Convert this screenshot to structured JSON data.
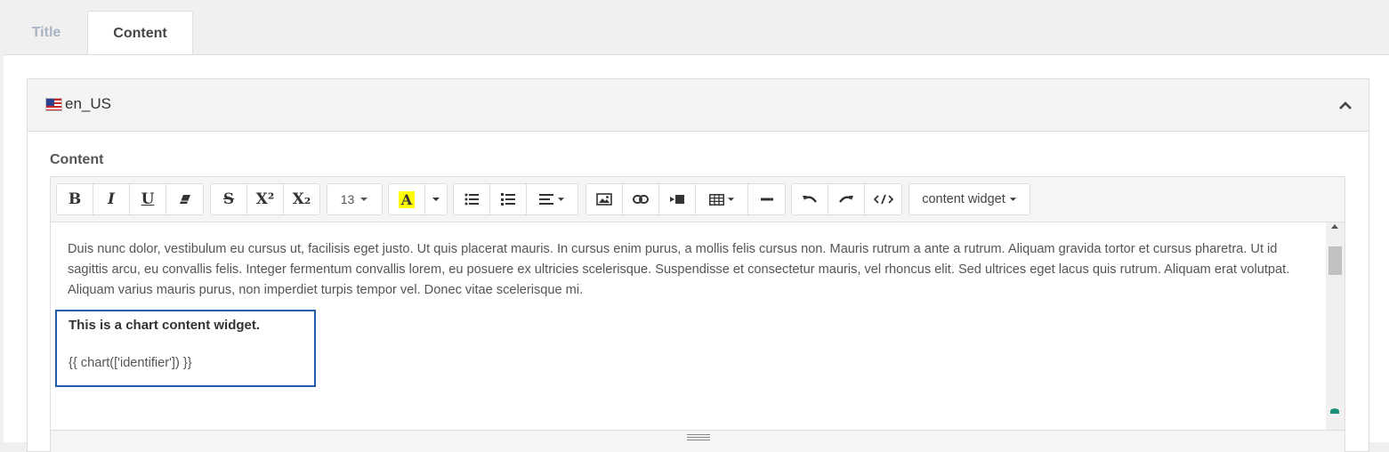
{
  "tabs": [
    {
      "label": "Title",
      "active": false
    },
    {
      "label": "Content",
      "active": true
    }
  ],
  "panel": {
    "flag_icon": "us-flag-icon",
    "locale": "en_US",
    "collapse_icon": "chevron-up-icon"
  },
  "field": {
    "label": "Content"
  },
  "toolbar": {
    "bold": "B",
    "italic": "I",
    "underline": "U",
    "strikethrough": "S",
    "superscript": "X²",
    "subscript": "X₂",
    "font_size": "13",
    "highlight": "A",
    "highlight_color": "#ffff00",
    "content_widget": "content widget"
  },
  "editor": {
    "paragraph": "Duis nunc dolor, vestibulum eu cursus ut, facilisis eget justo. Ut quis placerat mauris. In cursus enim purus, a mollis felis cursus non. Mauris rutrum a ante a rutrum. Aliquam gravida tortor et cursus pharetra. Ut id sagittis arcu, eu convallis felis. Integer fermentum convallis lorem, eu posuere ex ultricies scelerisque. Suspendisse et consectetur mauris, vel rhoncus elit. Sed ultrices eget lacus quis rutrum. Aliquam erat volutpat. Aliquam varius mauris purus, non imperdiet turpis tempor vel. Donec vitae scelerisque mi.",
    "widget_title": "This is a chart content widget.",
    "widget_code": "{{ chart(['identifier']) }}",
    "widget_border_color": "#1f5fa8"
  }
}
